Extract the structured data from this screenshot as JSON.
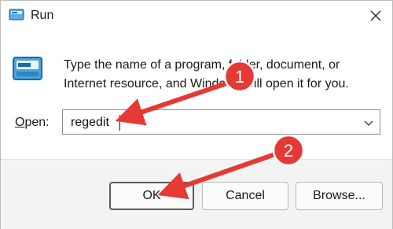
{
  "window": {
    "title": "Run",
    "close_label": "✕"
  },
  "dialog": {
    "description": "Type the name of a program, folder, document, or Internet resource, and Windows will open it for you.",
    "open_label_accesskey": "O",
    "open_label_rest": "pen:",
    "open_value": "regedit"
  },
  "buttons": {
    "ok": "OK",
    "cancel": "Cancel",
    "browse": "Browse..."
  },
  "annotations": [
    {
      "number": "1"
    },
    {
      "number": "2"
    }
  ],
  "colors": {
    "annotation_red": "#e53935",
    "footer_bg": "#f3f3f3",
    "icon_blue": "#1e88c9"
  },
  "icons": {
    "title": "run-app-icon",
    "dialog": "run-app-icon",
    "close": "close-icon",
    "dropdown": "chevron-down-icon"
  }
}
